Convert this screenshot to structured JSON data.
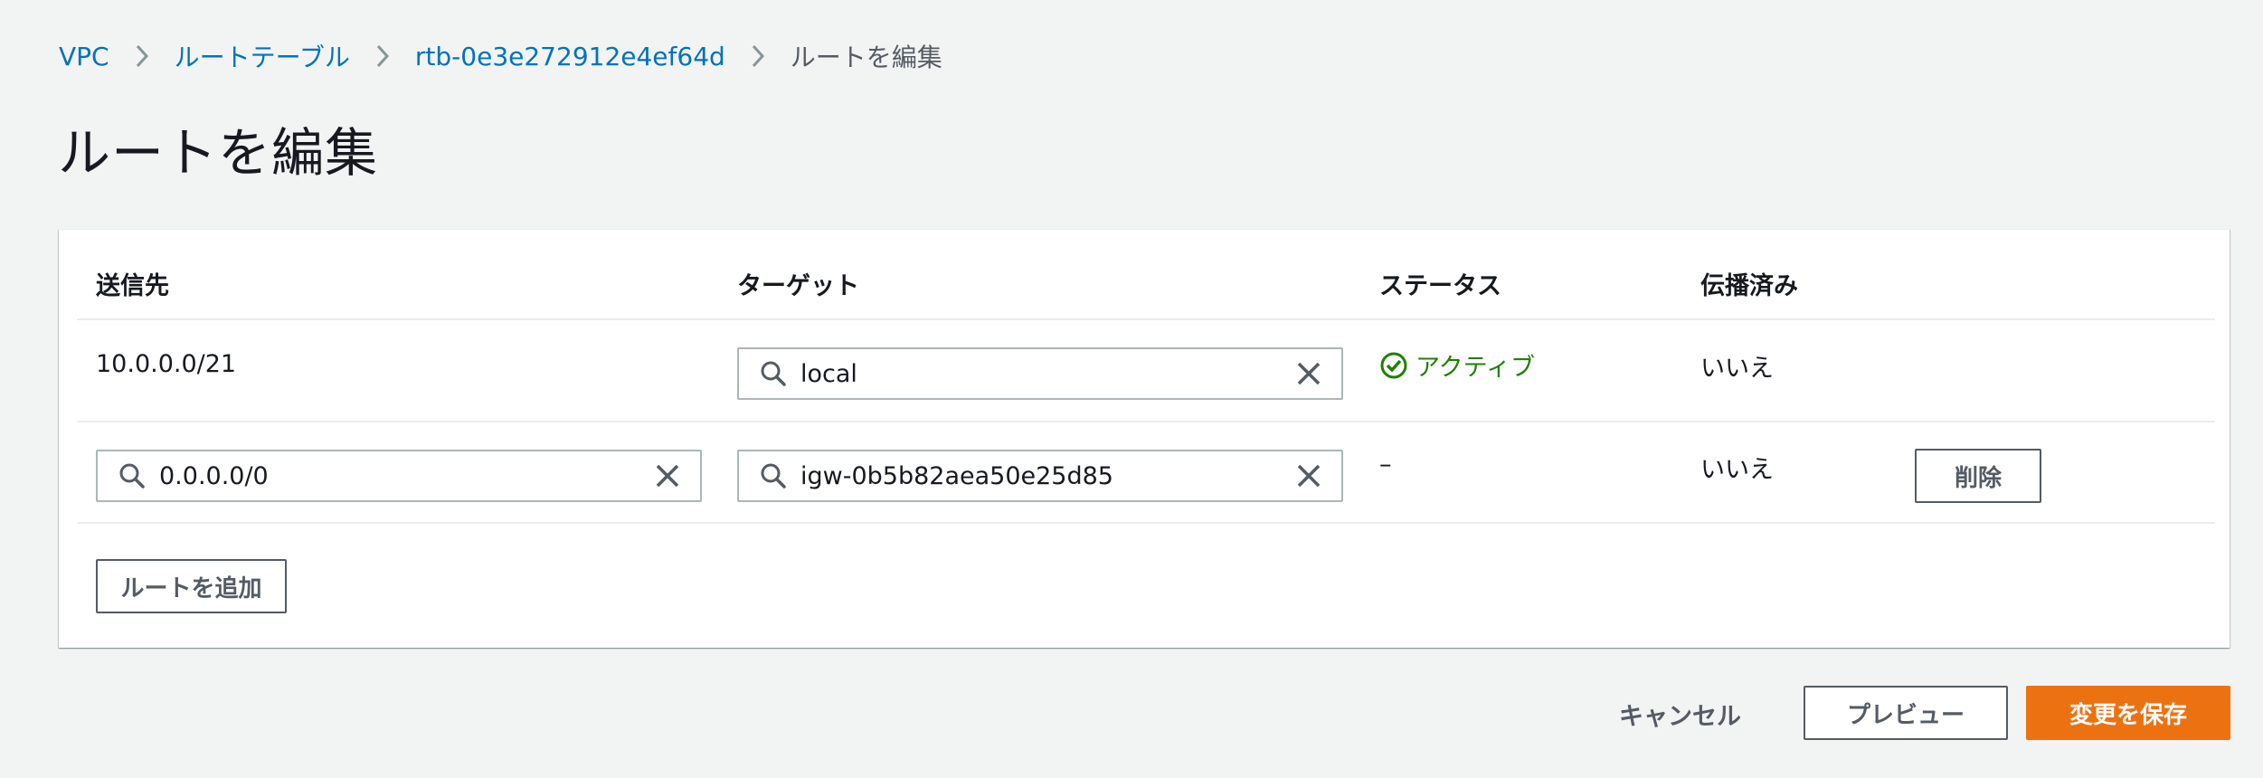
{
  "breadcrumb": {
    "items": [
      {
        "label": "VPC"
      },
      {
        "label": "ルートテーブル"
      },
      {
        "label": "rtb-0e3e272912e4ef64d"
      },
      {
        "label": "ルートを編集"
      }
    ]
  },
  "page": {
    "title": "ルートを編集"
  },
  "table": {
    "headers": {
      "destination": "送信先",
      "target": "ターゲット",
      "status": "ステータス",
      "propagated": "伝播済み"
    },
    "rows": [
      {
        "destination": "10.0.0.0/21",
        "target": "local",
        "status": "アクティブ",
        "propagated": "いいえ"
      },
      {
        "destination": "0.0.0.0/0",
        "target": "igw-0b5b82aea50e25d85",
        "status": "–",
        "propagated": "いいえ",
        "remove_label": "削除"
      }
    ],
    "add_route_label": "ルートを追加"
  },
  "footer": {
    "cancel_label": "キャンセル",
    "preview_label": "プレビュー",
    "save_label": "変更を保存"
  },
  "colors": {
    "link": "#0073bb",
    "success": "#1d8102",
    "primary": "#ec7211",
    "background": "#f2f3f3"
  },
  "icons": [
    "chevron-right-icon",
    "search-icon",
    "close-icon",
    "status-positive-icon"
  ]
}
